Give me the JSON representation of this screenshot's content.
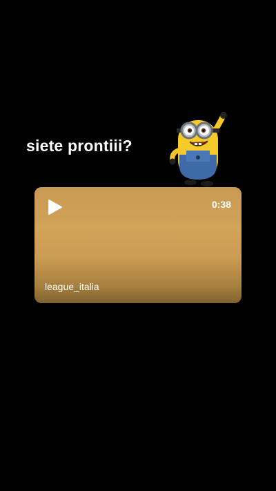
{
  "story": {
    "caption": "siete prontiii?",
    "sticker_icon": "minion-sticker"
  },
  "video_card": {
    "play_icon": "play-icon",
    "duration": "0:38",
    "source_label": "league_italia",
    "accent_color": "#cfa258"
  }
}
